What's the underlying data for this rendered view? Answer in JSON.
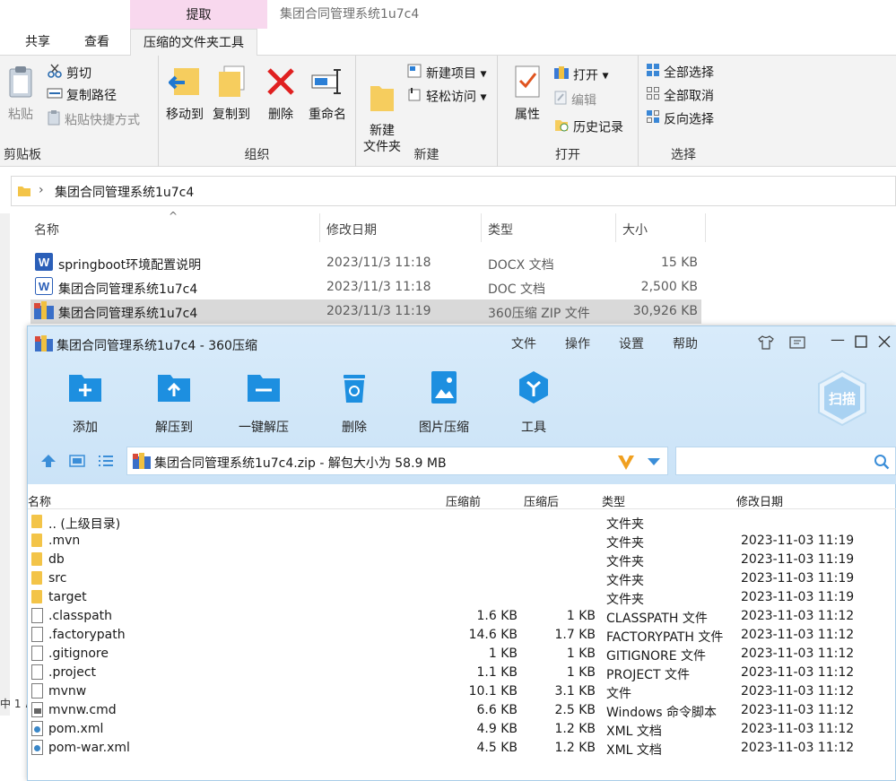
{
  "explorer": {
    "context_tab": "提取",
    "window_title": "集团合同管理系统1u7c4",
    "tabs": [
      "共享",
      "查看",
      "压缩的文件夹工具"
    ],
    "ribbon": {
      "clipboard": {
        "label": "剪贴板",
        "paste": "粘贴",
        "cut": "剪切",
        "copy_path": "复制路径",
        "paste_shortcut": "粘贴快捷方式"
      },
      "organize": {
        "label": "组织",
        "move_to": "移动到",
        "copy_to": "复制到",
        "delete": "删除",
        "rename": "重命名"
      },
      "new": {
        "label": "新建",
        "new_folder": "新建\n文件夹",
        "new_item": "新建项目",
        "easy_access": "轻松访问"
      },
      "open": {
        "label": "打开",
        "properties": "属性",
        "open": "打开",
        "edit": "编辑",
        "history": "历史记录"
      },
      "select": {
        "label": "选择",
        "select_all": "全部选择",
        "select_none": "全部取消",
        "invert": "反向选择"
      }
    },
    "address": "集团合同管理系统1u7c4",
    "columns": [
      "名称",
      "修改日期",
      "类型",
      "大小"
    ],
    "files": [
      {
        "name": "springboot环境配置说明",
        "date": "2023/11/3 11:18",
        "type": "DOCX 文档",
        "size": "15 KB"
      },
      {
        "name": "集团合同管理系统1u7c4",
        "date": "2023/11/3 11:18",
        "type": "DOC 文档",
        "size": "2,500 KB"
      },
      {
        "name": "集团合同管理系统1u7c4",
        "date": "2023/11/3 11:19",
        "type": "360压缩 ZIP 文件",
        "size": "30,926 KB"
      }
    ],
    "status_fragment": "中 1 ∧"
  },
  "zip": {
    "title": "集团合同管理系统1u7c4 - 360压缩",
    "menu": [
      "文件",
      "操作",
      "设置",
      "帮助"
    ],
    "tools": [
      "添加",
      "解压到",
      "一键解压",
      "删除",
      "图片压缩",
      "工具"
    ],
    "scan_label": "扫描",
    "path": "集团合同管理系统1u7c4.zip - 解包大小为 58.9 MB",
    "columns": [
      "名称",
      "压缩前",
      "压缩后",
      "类型",
      "修改日期"
    ],
    "colors": {
      "accent": "#1d8fe0",
      "header_bg": "#d3e8f9"
    },
    "rows": [
      {
        "icon": "folder",
        "name": ".. (上级目录)",
        "before": "",
        "after": "",
        "type": "文件夹",
        "date": ""
      },
      {
        "icon": "folder",
        "name": ".mvn",
        "before": "",
        "after": "",
        "type": "文件夹",
        "date": "2023-11-03 11:19"
      },
      {
        "icon": "folder",
        "name": "db",
        "before": "",
        "after": "",
        "type": "文件夹",
        "date": "2023-11-03 11:19"
      },
      {
        "icon": "folder",
        "name": "src",
        "before": "",
        "after": "",
        "type": "文件夹",
        "date": "2023-11-03 11:19"
      },
      {
        "icon": "folder",
        "name": "target",
        "before": "",
        "after": "",
        "type": "文件夹",
        "date": "2023-11-03 11:19"
      },
      {
        "icon": "file",
        "name": ".classpath",
        "before": "1.6 KB",
        "after": "1 KB",
        "type": "CLASSPATH 文件",
        "date": "2023-11-03 11:12"
      },
      {
        "icon": "file",
        "name": ".factorypath",
        "before": "14.6 KB",
        "after": "1.7 KB",
        "type": "FACTORYPATH 文件",
        "date": "2023-11-03 11:12"
      },
      {
        "icon": "file",
        "name": ".gitignore",
        "before": "1 KB",
        "after": "1 KB",
        "type": "GITIGNORE 文件",
        "date": "2023-11-03 11:12"
      },
      {
        "icon": "file",
        "name": ".project",
        "before": "1.1 KB",
        "after": "1 KB",
        "type": "PROJECT 文件",
        "date": "2023-11-03 11:12"
      },
      {
        "icon": "file",
        "name": "mvnw",
        "before": "10.1 KB",
        "after": "3.1 KB",
        "type": "文件",
        "date": "2023-11-03 11:12"
      },
      {
        "icon": "cmd",
        "name": "mvnw.cmd",
        "before": "6.6 KB",
        "after": "2.5 KB",
        "type": "Windows 命令脚本",
        "date": "2023-11-03 11:12"
      },
      {
        "icon": "xml",
        "name": "pom.xml",
        "before": "4.9 KB",
        "after": "1.2 KB",
        "type": "XML 文档",
        "date": "2023-11-03 11:12"
      },
      {
        "icon": "xml",
        "name": "pom-war.xml",
        "before": "4.5 KB",
        "after": "1.2 KB",
        "type": "XML 文档",
        "date": "2023-11-03 11:12"
      }
    ]
  }
}
